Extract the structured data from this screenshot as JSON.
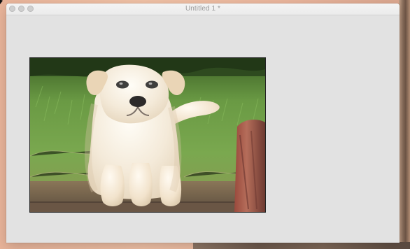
{
  "window": {
    "title": "Untitled 1 *"
  },
  "canvas": {
    "content": "puppy-photo"
  }
}
